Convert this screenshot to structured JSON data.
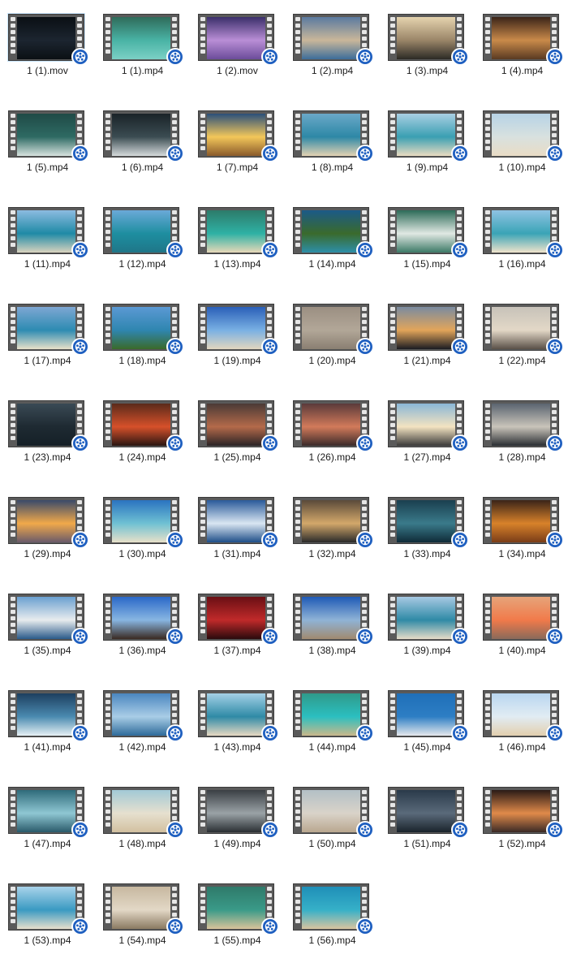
{
  "files": [
    {
      "name": "1 (1).mov",
      "colors": [
        "#0a0f14",
        "#1c2530",
        "#0b1014"
      ]
    },
    {
      "name": "1 (1).mp4",
      "colors": [
        "#2f6b5a",
        "#49b3a5",
        "#7bd0c5"
      ]
    },
    {
      "name": "1 (2).mov",
      "colors": [
        "#3a2f6a",
        "#b98ed6",
        "#6b4c9a"
      ]
    },
    {
      "name": "1 (2).mp4",
      "colors": [
        "#5a7aa0",
        "#c9b79a",
        "#3d6d9a"
      ]
    },
    {
      "name": "1 (3).mp4",
      "colors": [
        "#e5d3ae",
        "#9a8568",
        "#2c2a25"
      ]
    },
    {
      "name": "1 (4).mp4",
      "colors": [
        "#3a2418",
        "#c98a4a",
        "#5a3a22"
      ]
    },
    {
      "name": "1 (5).mp4",
      "colors": [
        "#1f4a46",
        "#2e6a63",
        "#d7e2de"
      ]
    },
    {
      "name": "1 (6).mp4",
      "colors": [
        "#1a2328",
        "#3b4c52",
        "#d5dadb"
      ]
    },
    {
      "name": "1 (7).mp4",
      "colors": [
        "#2b4f7a",
        "#f3c75a",
        "#8a5a2a"
      ]
    },
    {
      "name": "1 (8).mp4",
      "colors": [
        "#6aa8c8",
        "#2d88a6",
        "#e3d2b2"
      ]
    },
    {
      "name": "1 (9).mp4",
      "colors": [
        "#a9cfe3",
        "#3a9fb2",
        "#eadcc1"
      ]
    },
    {
      "name": "1 (10).mp4",
      "colors": [
        "#b7d3e6",
        "#d8e1df",
        "#e9dcc5"
      ]
    },
    {
      "name": "1 (11).mp4",
      "colors": [
        "#8cbbe0",
        "#1f8aa6",
        "#d9d3be"
      ]
    },
    {
      "name": "1 (12).mp4",
      "colors": [
        "#6aa9d8",
        "#1e8ea0",
        "#1f7688"
      ]
    },
    {
      "name": "1 (13).mp4",
      "colors": [
        "#2d7b6a",
        "#2eb1a4",
        "#e7d8b8"
      ]
    },
    {
      "name": "1 (14).mp4",
      "colors": [
        "#1b5a88",
        "#3a6a2c",
        "#2d8fa8"
      ]
    },
    {
      "name": "1 (15).mp4",
      "colors": [
        "#2d6b58",
        "#e0e8e3",
        "#3c7a67"
      ]
    },
    {
      "name": "1 (16).mp4",
      "colors": [
        "#8fc3e3",
        "#3aa4b6",
        "#efe3cb"
      ]
    },
    {
      "name": "1 (17).mp4",
      "colors": [
        "#7ea7d3",
        "#2d8bb2",
        "#e8e1c9"
      ]
    },
    {
      "name": "1 (18).mp4",
      "colors": [
        "#5b99d4",
        "#2f86b0",
        "#3a6a2a"
      ]
    },
    {
      "name": "1 (19).mp4",
      "colors": [
        "#2a5fb8",
        "#79b0e3",
        "#e2d6bf"
      ]
    },
    {
      "name": "1 (20).mp4",
      "colors": [
        "#9b8f82",
        "#b2a798",
        "#8a7f72"
      ]
    },
    {
      "name": "1 (21).mp4",
      "colors": [
        "#7a8ba0",
        "#e2a55a",
        "#1b1c22"
      ]
    },
    {
      "name": "1 (22).mp4",
      "colors": [
        "#c7c2b9",
        "#e3d8c7",
        "#5a5048"
      ]
    },
    {
      "name": "1 (23).mp4",
      "colors": [
        "#3a4a55",
        "#1e2a32",
        "#152027"
      ]
    },
    {
      "name": "1 (24).mp4",
      "colors": [
        "#5a2a1a",
        "#d6502a",
        "#2a1612"
      ]
    },
    {
      "name": "1 (25).mp4",
      "colors": [
        "#4a3a36",
        "#b46a4a",
        "#2a2326"
      ]
    },
    {
      "name": "1 (26).mp4",
      "colors": [
        "#5a3a3a",
        "#d27a5a",
        "#3a2a2a"
      ]
    },
    {
      "name": "1 (27).mp4",
      "colors": [
        "#8ab6d6",
        "#f3e3c1",
        "#3a3a3a"
      ]
    },
    {
      "name": "1 (28).mp4",
      "colors": [
        "#5a6470",
        "#c9c4ba",
        "#2a2e33"
      ]
    },
    {
      "name": "1 (29).mp4",
      "colors": [
        "#3a4a6a",
        "#f1a94a",
        "#6a5a6a"
      ]
    },
    {
      "name": "1 (30).mp4",
      "colors": [
        "#2a73c0",
        "#6fc1d3",
        "#e7e0c9"
      ]
    },
    {
      "name": "1 (31).mp4",
      "colors": [
        "#2a5a9a",
        "#d9e6f2",
        "#1e4e88"
      ]
    },
    {
      "name": "1 (32).mp4",
      "colors": [
        "#5a4a3a",
        "#d3a86a",
        "#2a2a2a"
      ]
    },
    {
      "name": "1 (33).mp4",
      "colors": [
        "#1a3f4f",
        "#3a7a8a",
        "#0f2b38"
      ]
    },
    {
      "name": "1 (34).mp4",
      "colors": [
        "#3a2418",
        "#d8822a",
        "#7a3c18"
      ]
    },
    {
      "name": "1 (35).mp4",
      "colors": [
        "#6aa0d0",
        "#e8ecee",
        "#2a5a8a"
      ]
    },
    {
      "name": "1 (36).mp4",
      "colors": [
        "#2a68c8",
        "#88b6e2",
        "#3a2a22"
      ]
    },
    {
      "name": "1 (37).mp4",
      "colors": [
        "#6a0f14",
        "#c02a2a",
        "#2a0a0d"
      ]
    },
    {
      "name": "1 (38).mp4",
      "colors": [
        "#1f5ab6",
        "#8fb3d6",
        "#a08a70"
      ]
    },
    {
      "name": "1 (39).mp4",
      "colors": [
        "#a7c9e3",
        "#2f8aa6",
        "#e6dcc8"
      ]
    },
    {
      "name": "1 (40).mp4",
      "colors": [
        "#e6a47a",
        "#f17a4a",
        "#8a6a5a"
      ]
    },
    {
      "name": "1 (41).mp4",
      "colors": [
        "#1d3f5f",
        "#4a8ab0",
        "#e6f0f4"
      ]
    },
    {
      "name": "1 (42).mp4",
      "colors": [
        "#4a86c0",
        "#a9cde6",
        "#2e6b9a"
      ]
    },
    {
      "name": "1 (43).mp4",
      "colors": [
        "#a4d0e6",
        "#2f8aa6",
        "#e7d9c2"
      ]
    },
    {
      "name": "1 (44).mp4",
      "colors": [
        "#2f9a8a",
        "#2bbfc0",
        "#c9b88a"
      ]
    },
    {
      "name": "1 (45).mp4",
      "colors": [
        "#1f6fb8",
        "#2d7ec4",
        "#e6e8ec"
      ]
    },
    {
      "name": "1 (46).mp4",
      "colors": [
        "#b9d6f0",
        "#e1ecf3",
        "#e2cfae"
      ]
    },
    {
      "name": "1 (47).mp4",
      "colors": [
        "#2f6b7a",
        "#8fc7d3",
        "#2a5a6a"
      ]
    },
    {
      "name": "1 (48).mp4",
      "colors": [
        "#a2c9d6",
        "#e6e0cf",
        "#d2c0a0"
      ]
    },
    {
      "name": "1 (49).mp4",
      "colors": [
        "#3a3f44",
        "#9aa2a6",
        "#2a2f33"
      ]
    },
    {
      "name": "1 (50).mp4",
      "colors": [
        "#b3c0c6",
        "#d9d3c9",
        "#b9a78f"
      ]
    },
    {
      "name": "1 (51).mp4",
      "colors": [
        "#2a3a4a",
        "#5a6a7a",
        "#1a232b"
      ]
    },
    {
      "name": "1 (52).mp4",
      "colors": [
        "#2a1a16",
        "#e08a4a",
        "#3a2a26"
      ]
    },
    {
      "name": "1 (53).mp4",
      "colors": [
        "#a9d3ea",
        "#3a9ac2",
        "#e7dfcc"
      ]
    },
    {
      "name": "1 (54).mp4",
      "colors": [
        "#c7b8a0",
        "#e3d8c6",
        "#8a7a62"
      ]
    },
    {
      "name": "1 (55).mp4",
      "colors": [
        "#2f7a6a",
        "#3a9a88",
        "#d8c39a"
      ]
    },
    {
      "name": "1 (56).mp4",
      "colors": [
        "#1f8fb8",
        "#36b0c8",
        "#d8c4a0"
      ]
    }
  ],
  "icons": {
    "badge": "media-player-reel-icon",
    "badge_color": "#1e5fc0"
  }
}
